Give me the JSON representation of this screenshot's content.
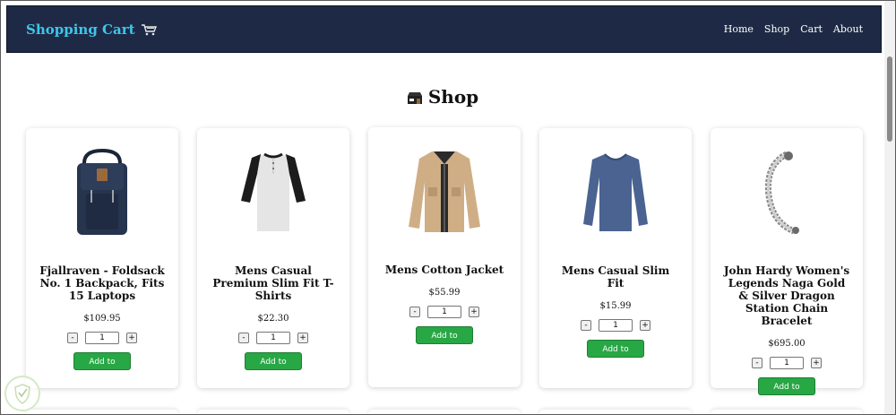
{
  "navbar": {
    "brand": "Shopping Cart",
    "brand_icon": "shopping-cart-icon",
    "links": [
      "Home",
      "Shop",
      "Cart",
      "About"
    ]
  },
  "page": {
    "title": "Shop",
    "title_icon": "shop-icon"
  },
  "products": [
    {
      "title": "Fjallraven - Foldsack No. 1 Backpack, Fits 15 Laptops",
      "price": "$109.95",
      "qty": "1",
      "minus": "-",
      "plus": "+",
      "button": "Add to Cart",
      "image": "backpack-image"
    },
    {
      "title": "Mens Casual Premium Slim Fit T-Shirts",
      "price": "$22.30",
      "qty": "1",
      "minus": "-",
      "plus": "+",
      "button": "Add to Cart",
      "image": "tshirt-image"
    },
    {
      "title": "Mens Cotton Jacket",
      "price": "$55.99",
      "qty": "1",
      "minus": "-",
      "plus": "+",
      "button": "Add to Cart",
      "image": "jacket-image"
    },
    {
      "title": "Mens Casual Slim Fit",
      "price": "$15.99",
      "qty": "1",
      "minus": "-",
      "plus": "+",
      "button": "Add to Cart",
      "image": "longsleeve-image"
    },
    {
      "title": "John Hardy Women's Legends Naga Gold & Silver Dragon Station Chain Bracelet",
      "price": "$695.00",
      "qty": "1",
      "minus": "-",
      "plus": "+",
      "button": "Add to Cart",
      "image": "bracelet-image"
    }
  ],
  "colors": {
    "navbar_bg": "#1e2a45",
    "brand": "#3ec6ea",
    "button_bg": "#28a745"
  }
}
